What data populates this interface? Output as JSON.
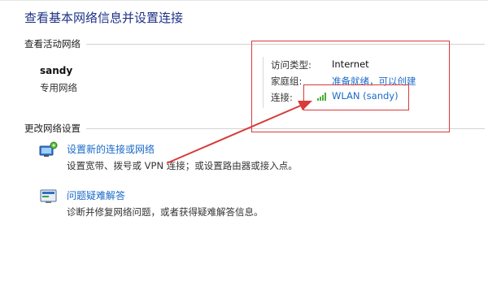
{
  "header": {
    "title": "查看基本网络信息并设置连接"
  },
  "active_networks": {
    "section_title": "查看活动网络",
    "network_name": "sandy",
    "network_type": "专用网络",
    "access_type_label": "访问类型:",
    "access_type_value": "Internet",
    "homegroup_label": "家庭组:",
    "homegroup_value": "准备就绪，可以创建",
    "connection_label": "连接:",
    "connection_value": "WLAN (sandy)"
  },
  "change_settings": {
    "section_title": "更改网络设置",
    "tasks": [
      {
        "link": "设置新的连接或网络",
        "desc": "设置宽带、拨号或 VPN 连接；或设置路由器或接入点。",
        "icon": "network-setup-icon"
      },
      {
        "link": "问题疑难解答",
        "desc": "诊断并修复网络问题，或者获得疑难解答信息。",
        "icon": "troubleshoot-icon"
      }
    ]
  },
  "colors": {
    "title": "#1e3287",
    "link": "#1a6ac8",
    "annotation": "#d93a3a",
    "signal": "#4cae36"
  }
}
